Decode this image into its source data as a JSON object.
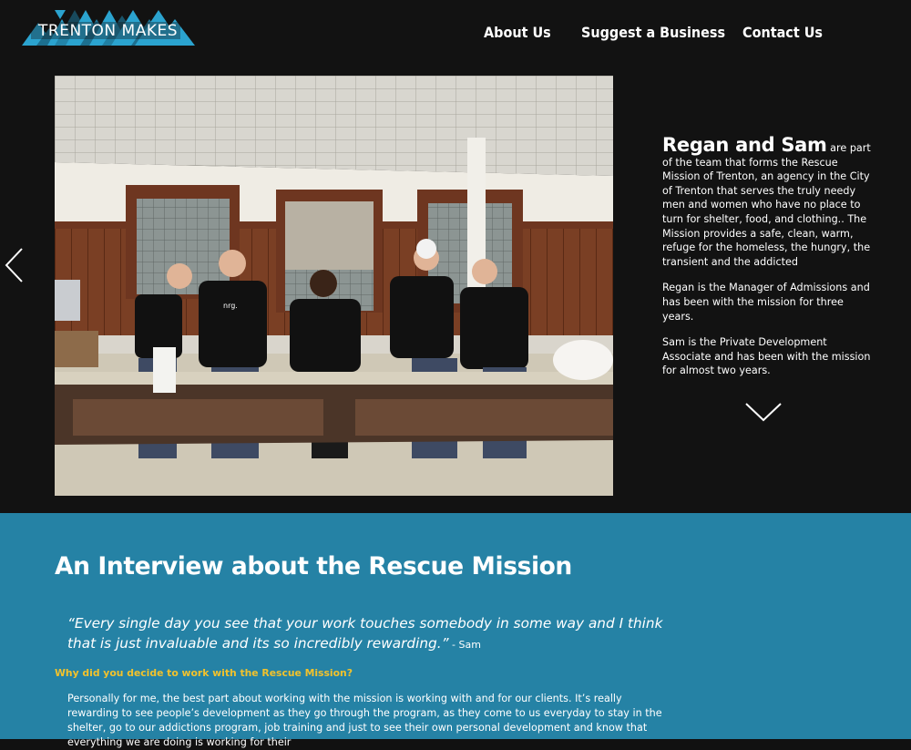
{
  "header": {
    "logo_text": "TRENTON MAKES",
    "nav": [
      {
        "label": "About Us"
      },
      {
        "label": "Suggest a Business"
      },
      {
        "label": "Contact Us"
      }
    ]
  },
  "feature": {
    "names": "Regan and Sam",
    "intro": " are part of the team that forms the Rescue Mission of Trenton, an agency in the City of Trenton that serves the truly needy men and women who have no place to turn for shelter, food, and clothing.. The Mission provides a safe, clean, warm, refuge for the homeless, the hungry, the transient and the addicted",
    "para2": "Regan is the Manager of Admissions and has been with the mission for three years.",
    "para3": "Sam is the Private Development Associate and has been with the mission for almost two years.",
    "shirt_logo": "nrg."
  },
  "interview": {
    "heading": "An Interview about the Rescue Mission",
    "quote": "“Every single day you see that your work touches somebody in some way and I think that is just invaluable and its so incredibly rewarding.”",
    "quote_author": " - Sam",
    "question": "Why did you decide to work with the Rescue Mission?",
    "answer": "Personally for me, the best part about working with the mission is working with and for our clients. It’s really rewarding to see people’s development as they go through the program, as they come to us everyday to stay in the shelter, go to our addictions program, job training and just to see their own personal development and know that everything we are doing is working for their"
  },
  "colors": {
    "header_bg": "#121212",
    "section_bg": "#2582a5",
    "logo_blue": "#2ba3cf",
    "question_color": "#f2c22c"
  }
}
